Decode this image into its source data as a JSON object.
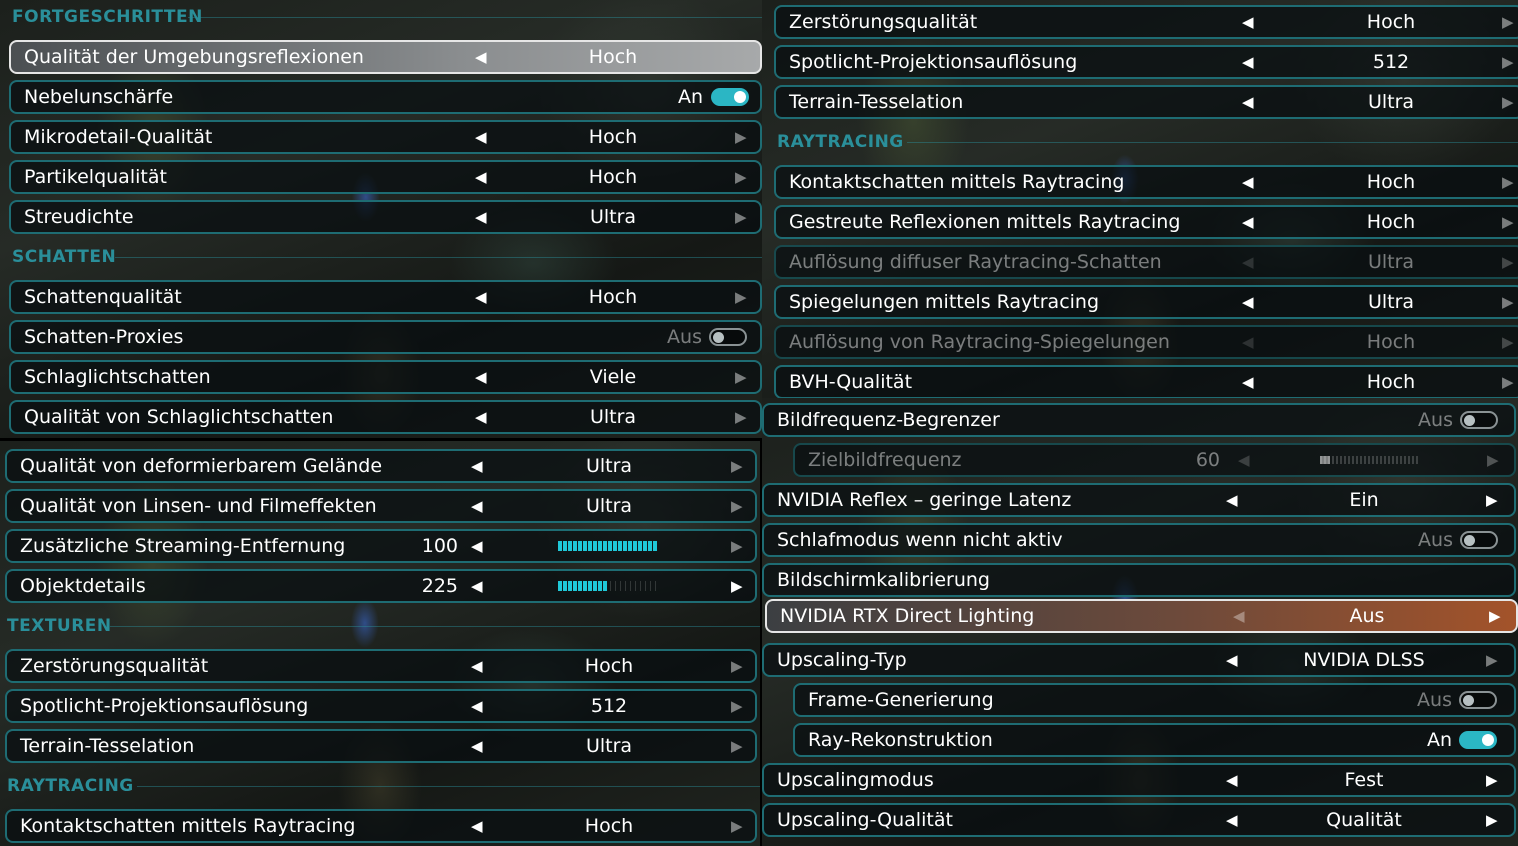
{
  "q1": {
    "sections": {
      "advanced": "FORTGESCHRITTEN",
      "shadows": "SCHATTEN"
    },
    "rows": [
      {
        "label": "Qualität der Umgebungsreflexionen",
        "value": "Hoch"
      },
      {
        "label": "Nebelunschärfe",
        "toggle": "An"
      },
      {
        "label": "Mikrodetail-Qualität",
        "value": "Hoch"
      },
      {
        "label": "Partikelqualität",
        "value": "Hoch"
      },
      {
        "label": "Streudichte",
        "value": "Ultra"
      },
      {
        "label": "Schattenqualität",
        "value": "Hoch"
      },
      {
        "label": "Schatten-Proxies",
        "toggle": "Aus"
      },
      {
        "label": "Schlaglichtschatten",
        "value": "Viele"
      },
      {
        "label": "Qualität von Schlaglichtschatten",
        "value": "Ultra"
      }
    ]
  },
  "q2": {
    "sections": {
      "raytracing": "RAYTRACING"
    },
    "rows": [
      {
        "label": "Zerstörungsqualität",
        "value": "Hoch"
      },
      {
        "label": "Spotlicht-Projektionsauflösung",
        "value": "512"
      },
      {
        "label": "Terrain-Tesselation",
        "value": "Ultra"
      },
      {
        "label": "Kontaktschatten mittels Raytracing",
        "value": "Hoch"
      },
      {
        "label": "Gestreute Reflexionen mittels Raytracing",
        "value": "Hoch"
      },
      {
        "label": "Auflösung diffuser Raytracing-Schatten",
        "value": "Ultra"
      },
      {
        "label": "Spiegelungen mittels Raytracing",
        "value": "Ultra"
      },
      {
        "label": "Auflösung von Raytracing-Spiegelungen",
        "value": "Hoch"
      },
      {
        "label": "BVH-Qualität",
        "value": "Hoch"
      }
    ]
  },
  "q3": {
    "sections": {
      "textures": "TEXTUREN",
      "raytracing": "RAYTRACING"
    },
    "rows": [
      {
        "label": "Qualität von deformierbarem Gelände",
        "value": "Ultra"
      },
      {
        "label": "Qualität von Linsen- und Filmeffekten",
        "value": "Ultra"
      },
      {
        "label": "Zusätzliche Streaming-Entfernung",
        "number": "100",
        "slider_fraction": 1.0
      },
      {
        "label": "Objektdetails",
        "number": "225",
        "slider_fraction": 0.5
      },
      {
        "label": "Zerstörungsqualität",
        "value": "Hoch"
      },
      {
        "label": "Spotlicht-Projektionsauflösung",
        "value": "512"
      },
      {
        "label": "Terrain-Tesselation",
        "value": "Ultra"
      },
      {
        "label": "Kontaktschatten mittels Raytracing",
        "value": "Hoch"
      }
    ]
  },
  "q4": {
    "rows": [
      {
        "label": "Bildfrequenz-Begrenzer",
        "toggle": "Aus"
      },
      {
        "label": "Zielbildfrequenz",
        "number": "60",
        "slider_fraction": 0.1
      },
      {
        "label": "NVIDIA Reflex – geringe Latenz",
        "value": "Ein"
      },
      {
        "label": "Schlafmodus wenn nicht aktiv",
        "toggle": "Aus"
      },
      {
        "label": "Bildschirmkalibrierung"
      },
      {
        "label": "NVIDIA RTX Direct Lighting",
        "value": "Aus"
      },
      {
        "label": "Upscaling-Typ",
        "value": "NVIDIA DLSS"
      },
      {
        "label": "Frame-Generierung",
        "toggle": "Aus"
      },
      {
        "label": "Ray-Rekonstruktion",
        "toggle": "An"
      },
      {
        "label": "Upscalingmodus",
        "value": "Fest"
      },
      {
        "label": "Upscaling-Qualität",
        "value": "Qualität"
      }
    ]
  },
  "icons": {
    "left": "◀",
    "right": "▶"
  },
  "colors": {
    "accent": "#2bb6c4",
    "border": "#1e6c73",
    "section": "#2a8f9a",
    "highlight": "#a3532a"
  }
}
